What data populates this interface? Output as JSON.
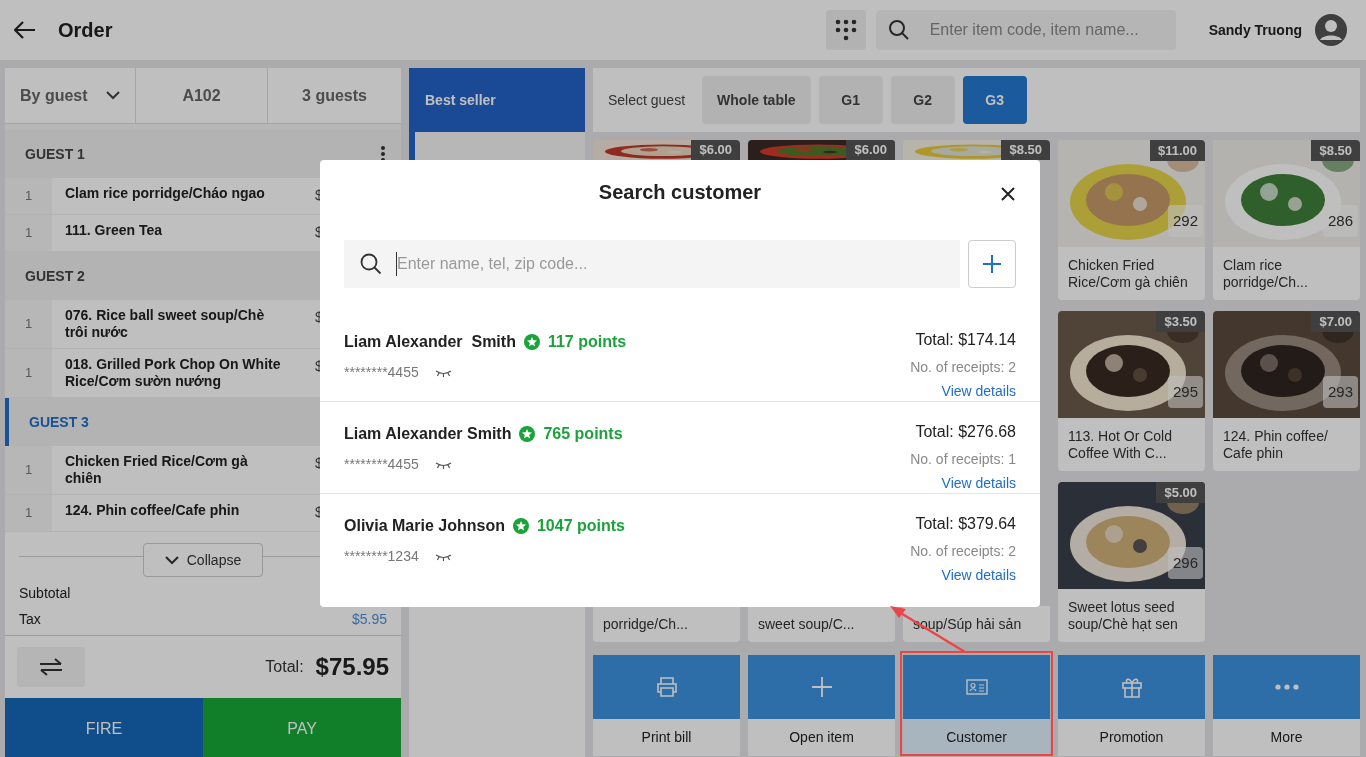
{
  "header": {
    "title": "Order",
    "search_placeholder": "Enter item code, item name...",
    "user": "Sandy Truong"
  },
  "order": {
    "mode": "By guest",
    "table": "A102",
    "guests_count": "3 guests",
    "guests": [
      {
        "label": "GUEST 1",
        "selected": false,
        "items": [
          {
            "qty": "1",
            "name": "Clam rice porridge/Cháo ngao",
            "price": "$"
          },
          {
            "qty": "1",
            "name": "111. Green Tea",
            "price": "$"
          }
        ]
      },
      {
        "label": "GUEST 2",
        "selected": false,
        "items": [
          {
            "qty": "1",
            "name": "076. Rice ball sweet soup/Chè trôi nước",
            "price": "$"
          },
          {
            "qty": "1",
            "name": "018. Grilled Pork Chop On White Rice/Cơm sườn nướng",
            "price": "$"
          }
        ]
      },
      {
        "label": "GUEST 3",
        "selected": true,
        "items": [
          {
            "qty": "1",
            "name": "Chicken Fried Rice/Cơm gà chiên",
            "price": "$"
          },
          {
            "qty": "1",
            "name": "124. Phin coffee/Cafe phin",
            "price": "$"
          }
        ]
      }
    ],
    "collapse": "Collapse",
    "subtotal_label": "Subtotal",
    "tax_label": "Tax",
    "tax": "$5.95",
    "total_label": "Total:",
    "total": "$75.95",
    "fire": "FIRE",
    "pay": "PAY"
  },
  "categories": [
    {
      "label": "Best seller",
      "selected": true
    },
    {
      "selected": false
    }
  ],
  "guest_select": {
    "label": "Select guest",
    "options": [
      {
        "label": "Whole table",
        "selected": false
      },
      {
        "label": "G1",
        "selected": false
      },
      {
        "label": "G2",
        "selected": false
      },
      {
        "label": "G3",
        "selected": true
      }
    ]
  },
  "products": [
    {
      "kind": "top_strip",
      "price": "$6.00"
    },
    {
      "kind": "top_strip",
      "price": "$6.00"
    },
    {
      "kind": "top_strip",
      "price": "$8.50"
    },
    {
      "kind": "card",
      "price": "$11.00",
      "code": "292",
      "name": "Chicken Fried Rice/Cơm gà chiên"
    },
    {
      "kind": "card",
      "price": "$8.50",
      "code": "286",
      "name": "Clam rice porridge/Ch..."
    },
    {
      "kind": "covered"
    },
    {
      "kind": "covered"
    },
    {
      "kind": "covered"
    },
    {
      "kind": "card",
      "price": "$3.50",
      "code": "295",
      "name": "113. Hot Or Cold Coffee With C..."
    },
    {
      "kind": "card",
      "price": "$7.00",
      "code": "293",
      "name": "124. Phin coffee/ Cafe phin"
    },
    {
      "kind": "bottom_strip",
      "name": "porridge/Ch..."
    },
    {
      "kind": "bottom_strip",
      "name": "sweet soup/C..."
    },
    {
      "kind": "bottom_strip",
      "name": "soup/Súp hải sản"
    },
    {
      "kind": "card",
      "price": "$5.00",
      "code": "296",
      "name": "Sweet lotus seed soup/Chè hạt sen"
    }
  ],
  "actions": [
    {
      "kind": "print",
      "label": "Print bill",
      "selected": false,
      "highlighted": false
    },
    {
      "kind": "add",
      "label": "Open item",
      "selected": false,
      "highlighted": false
    },
    {
      "kind": "customer",
      "label": "Customer",
      "selected": true,
      "highlighted": true
    },
    {
      "kind": "promotion",
      "label": "Promotion",
      "selected": false,
      "highlighted": false
    },
    {
      "kind": "more",
      "label": "More",
      "selected": false,
      "highlighted": false
    }
  ],
  "modal": {
    "title": "Search customer",
    "search_placeholder": "Enter name, tel, zip code...",
    "customers": [
      {
        "name": "Liam Alexander  Smith",
        "points": "117 points",
        "phone": "********4455",
        "total": "Total: $174.14",
        "receipts": "No. of receipts: 2",
        "link": "View details"
      },
      {
        "name": "Liam Alexander Smith",
        "points": "765 points",
        "phone": "********4455",
        "total": "Total: $276.68",
        "receipts": "No. of receipts: 1",
        "link": "View details"
      },
      {
        "name": "Olivia Marie Johnson",
        "points": "1047 points",
        "phone": "********1234",
        "total": "Total: $379.64",
        "receipts": "No. of receipts: 2",
        "link": "View details"
      }
    ]
  }
}
